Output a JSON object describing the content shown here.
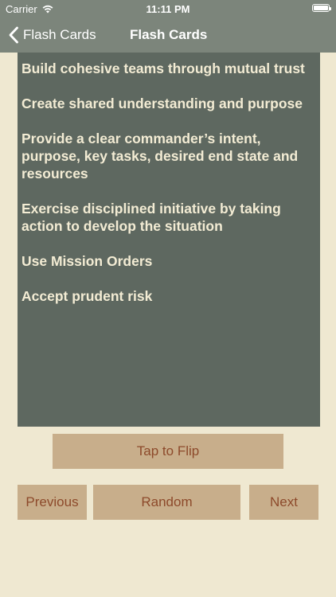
{
  "status_bar": {
    "carrier": "Carrier",
    "time": "11:11 PM"
  },
  "nav": {
    "back_label": "Flash Cards",
    "title": "Flash Cards"
  },
  "card": {
    "items": [
      "Build cohesive teams through mutual trust",
      "Create shared understanding and purpose",
      "Provide a clear commander’s intent, purpose, key tasks, desired end state and resources",
      "Exercise disciplined initiative by taking action to develop the situation",
      "Use Mission Orders",
      "Accept prudent risk"
    ]
  },
  "buttons": {
    "flip": "Tap to Flip",
    "previous": "Previous",
    "random": "Random",
    "next": "Next"
  },
  "colors": {
    "nav_bar": "#7c857b",
    "card_bg": "#5e6860",
    "card_text": "#f3ecd4",
    "page_bg": "#efe8d1",
    "button_bg": "#c8ae8b",
    "button_text": "#8d4a2b"
  }
}
